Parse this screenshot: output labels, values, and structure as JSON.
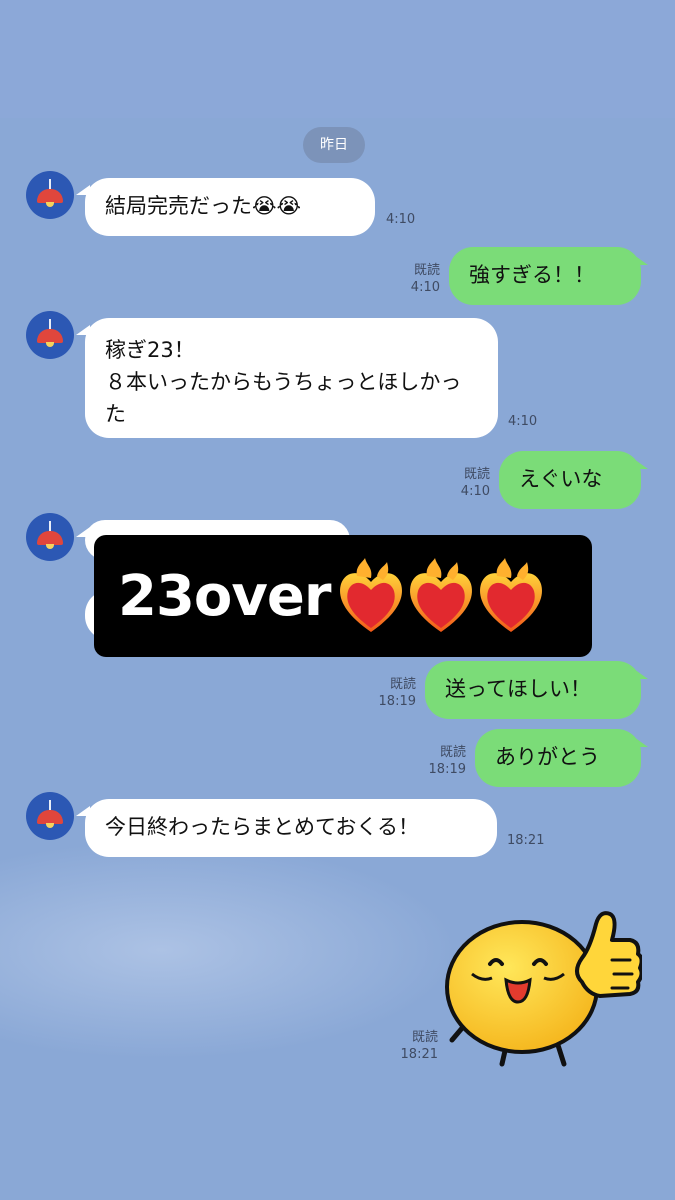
{
  "date_divider": "昨日",
  "messages": {
    "m1": {
      "text": "結局完売だった😭😭",
      "time": "4:10"
    },
    "m2": {
      "text": "強すぎる！！",
      "read": "既読",
      "time": "4:10"
    },
    "m3": {
      "text": "稼ぎ23！\n８本いったからもうちょっとほしかった",
      "time": "4:10"
    },
    "m4": {
      "text": "えぐいな",
      "read": "既読",
      "time": "4:10"
    },
    "m6": {
      "text": "送ってほしい！",
      "read": "既読",
      "time": "18:19"
    },
    "m7": {
      "text": "ありがとう",
      "read": "既読",
      "time": "18:19"
    },
    "m8": {
      "text": "今日終わったらまとめておくる！",
      "time": "18:21"
    },
    "m9": {
      "read": "既読",
      "time": "18:21"
    }
  },
  "overlay": {
    "text": "23over"
  },
  "icons": {
    "avatar": "pendant-lamp-icon",
    "sticker": "thumbs-up-emoji-sticker",
    "hearts": "heart-on-fire-icon"
  },
  "colors": {
    "background": "#8aa8d6",
    "incoming": "#ffffff",
    "outgoing": "#7bdc78",
    "overlay": "#000000"
  }
}
